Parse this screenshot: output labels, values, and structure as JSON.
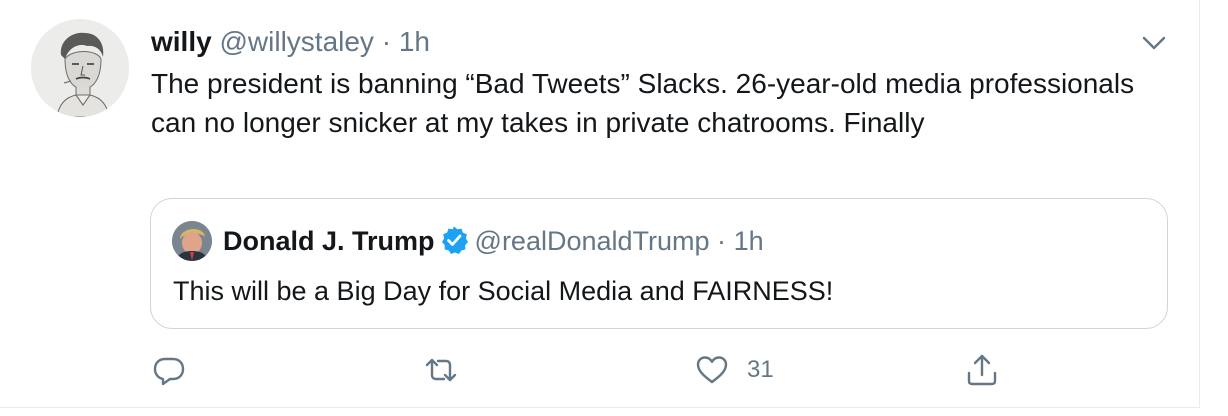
{
  "tweet": {
    "author_name": "willy",
    "author_handle": "@willystaley",
    "separator": "·",
    "time": "1h",
    "text": "The president is banning “Bad Tweets” Slacks. 26-year-old media professionals can no longer snicker at my takes in private chatrooms. Finally",
    "quoted": {
      "author_name": "Donald J. Trump",
      "author_handle": "@realDonaldTrump",
      "separator": "·",
      "time": "1h",
      "verified": true,
      "text": "This will be a Big Day for Social Media and FAIRNESS!"
    },
    "actions": {
      "reply_icon": "reply-icon",
      "retweet_icon": "retweet-icon",
      "like_icon": "heart-icon",
      "like_count": "31",
      "share_icon": "share-icon"
    }
  },
  "colors": {
    "text": "#14171a",
    "secondary": "#657786",
    "border": "#ccd6dd",
    "verified": "#1da1f2"
  }
}
